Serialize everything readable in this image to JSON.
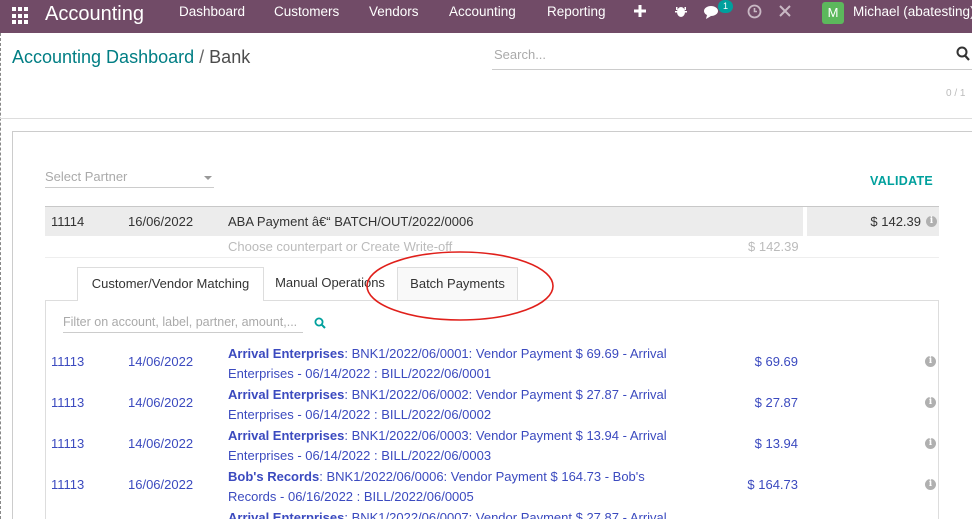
{
  "navbar": {
    "brand": "Accounting",
    "menu": [
      "Dashboard",
      "Customers",
      "Vendors",
      "Accounting",
      "Reporting"
    ],
    "chat_badge": "1",
    "avatar_letter": "M",
    "user": "Michael (abatesting)"
  },
  "control_panel": {
    "breadcrumb_parent": "Accounting Dashboard",
    "breadcrumb_separator": "/",
    "breadcrumb_current": "Bank",
    "search_placeholder": "Search...",
    "pager": "0 / 1"
  },
  "reconcile": {
    "partner_placeholder": "Select Partner",
    "validate_label": "VALIDATE",
    "statement_line": {
      "id": "11114",
      "date": "16/06/2022",
      "label": "ABA Payment â€“ BATCH/OUT/2022/0006",
      "amount": "$ 142.39"
    },
    "counterpart": {
      "label": "Choose counterpart or Create Write-off",
      "amount": "$ 142.39"
    },
    "tabs": [
      "Customer/Vendor Matching",
      "Manual Operations",
      "Batch Payments"
    ],
    "filter_placeholder": "Filter on account, label, partner, amount,...",
    "matches": [
      {
        "id": "11113",
        "date": "14/06/2022",
        "partner": "Arrival Enterprises",
        "label": ": BNK1/2022/06/0001: Vendor Payment $ 69.69 - Arrival Enterprises - 06/14/2022 : BILL/2022/06/0001",
        "amount": "$ 69.69"
      },
      {
        "id": "11113",
        "date": "14/06/2022",
        "partner": "Arrival Enterprises",
        "label": ": BNK1/2022/06/0002: Vendor Payment $ 27.87 - Arrival Enterprises - 06/14/2022 : BILL/2022/06/0002",
        "amount": "$ 27.87"
      },
      {
        "id": "11113",
        "date": "14/06/2022",
        "partner": "Arrival Enterprises",
        "label": ": BNK1/2022/06/0003: Vendor Payment $ 13.94 - Arrival Enterprises - 06/14/2022 : BILL/2022/06/0003",
        "amount": "$ 13.94"
      },
      {
        "id": "11113",
        "date": "16/06/2022",
        "partner": "Bob's Records",
        "label": ": BNK1/2022/06/0006: Vendor Payment $ 164.73 - Bob's Records - 06/16/2022 : BILL/2022/06/0005",
        "amount": "$ 164.73"
      },
      {
        "id": "",
        "date": "",
        "partner": "Arrival Enterprises",
        "label": ": BNK1/2022/06/0007: Vendor Payment $ 27.87 - Arrival",
        "amount": ""
      }
    ]
  },
  "colors": {
    "navbar": "#714b67",
    "link": "#3b4abf",
    "accent": "#00a09d",
    "annotation": "#e0201b"
  }
}
